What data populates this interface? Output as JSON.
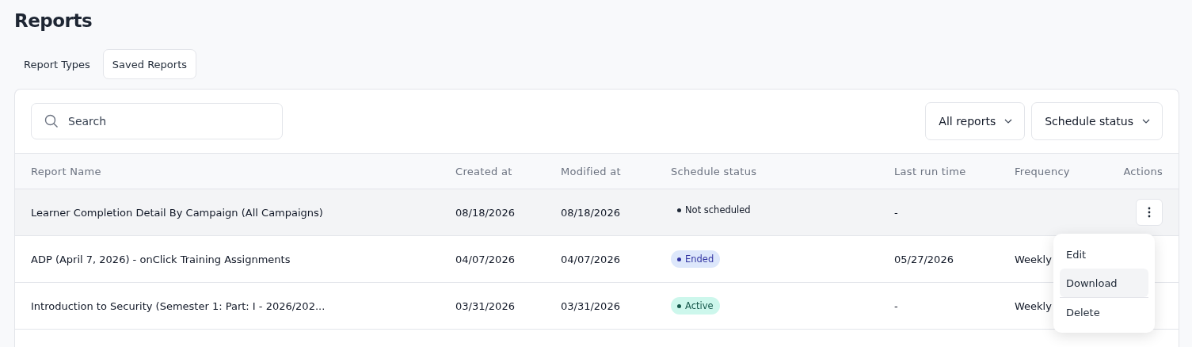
{
  "title": "Reports",
  "tabs": [
    {
      "label": "Report Types",
      "selected": false
    },
    {
      "label": "Saved Reports",
      "selected": true
    }
  ],
  "search": {
    "placeholder": "Search"
  },
  "filters": [
    {
      "label": "All reports"
    },
    {
      "label": "Schedule status"
    }
  ],
  "table": {
    "columns": [
      "Report Name",
      "Created at",
      "Modified at",
      "Schedule status",
      "Last run time",
      "Frequency",
      "Actions"
    ],
    "rows": [
      {
        "name": "Learner Completion Detail By Campaign (All Campaigns)",
        "created": "08/18/2026",
        "modified": "08/18/2026",
        "status": {
          "kind": "not_scheduled",
          "label": "Not scheduled"
        },
        "last_run": "-",
        "selected": true,
        "menu_open": true
      },
      {
        "name": "ADP (April 7, 2026) - onClick Training Assignments",
        "created": "04/07/2026",
        "modified": "04/07/2026",
        "status": {
          "kind": "ended",
          "label": "Ended"
        },
        "last_run": "05/27/2026",
        "frequency": "Weekly",
        "selected": false
      },
      {
        "name": "Introduction to Security (Semester 1: Part: I - 2026/202...",
        "created": "03/31/2026",
        "modified": "03/31/2026",
        "status": {
          "kind": "active",
          "label": "Active"
        },
        "last_run": "-",
        "frequency": "Weekly",
        "selected": false
      }
    ]
  },
  "action_menu": {
    "items": [
      {
        "label": "Edit",
        "selected": false
      },
      {
        "label": "Download",
        "selected": true
      },
      {
        "label": "Delete",
        "selected": false
      }
    ]
  }
}
